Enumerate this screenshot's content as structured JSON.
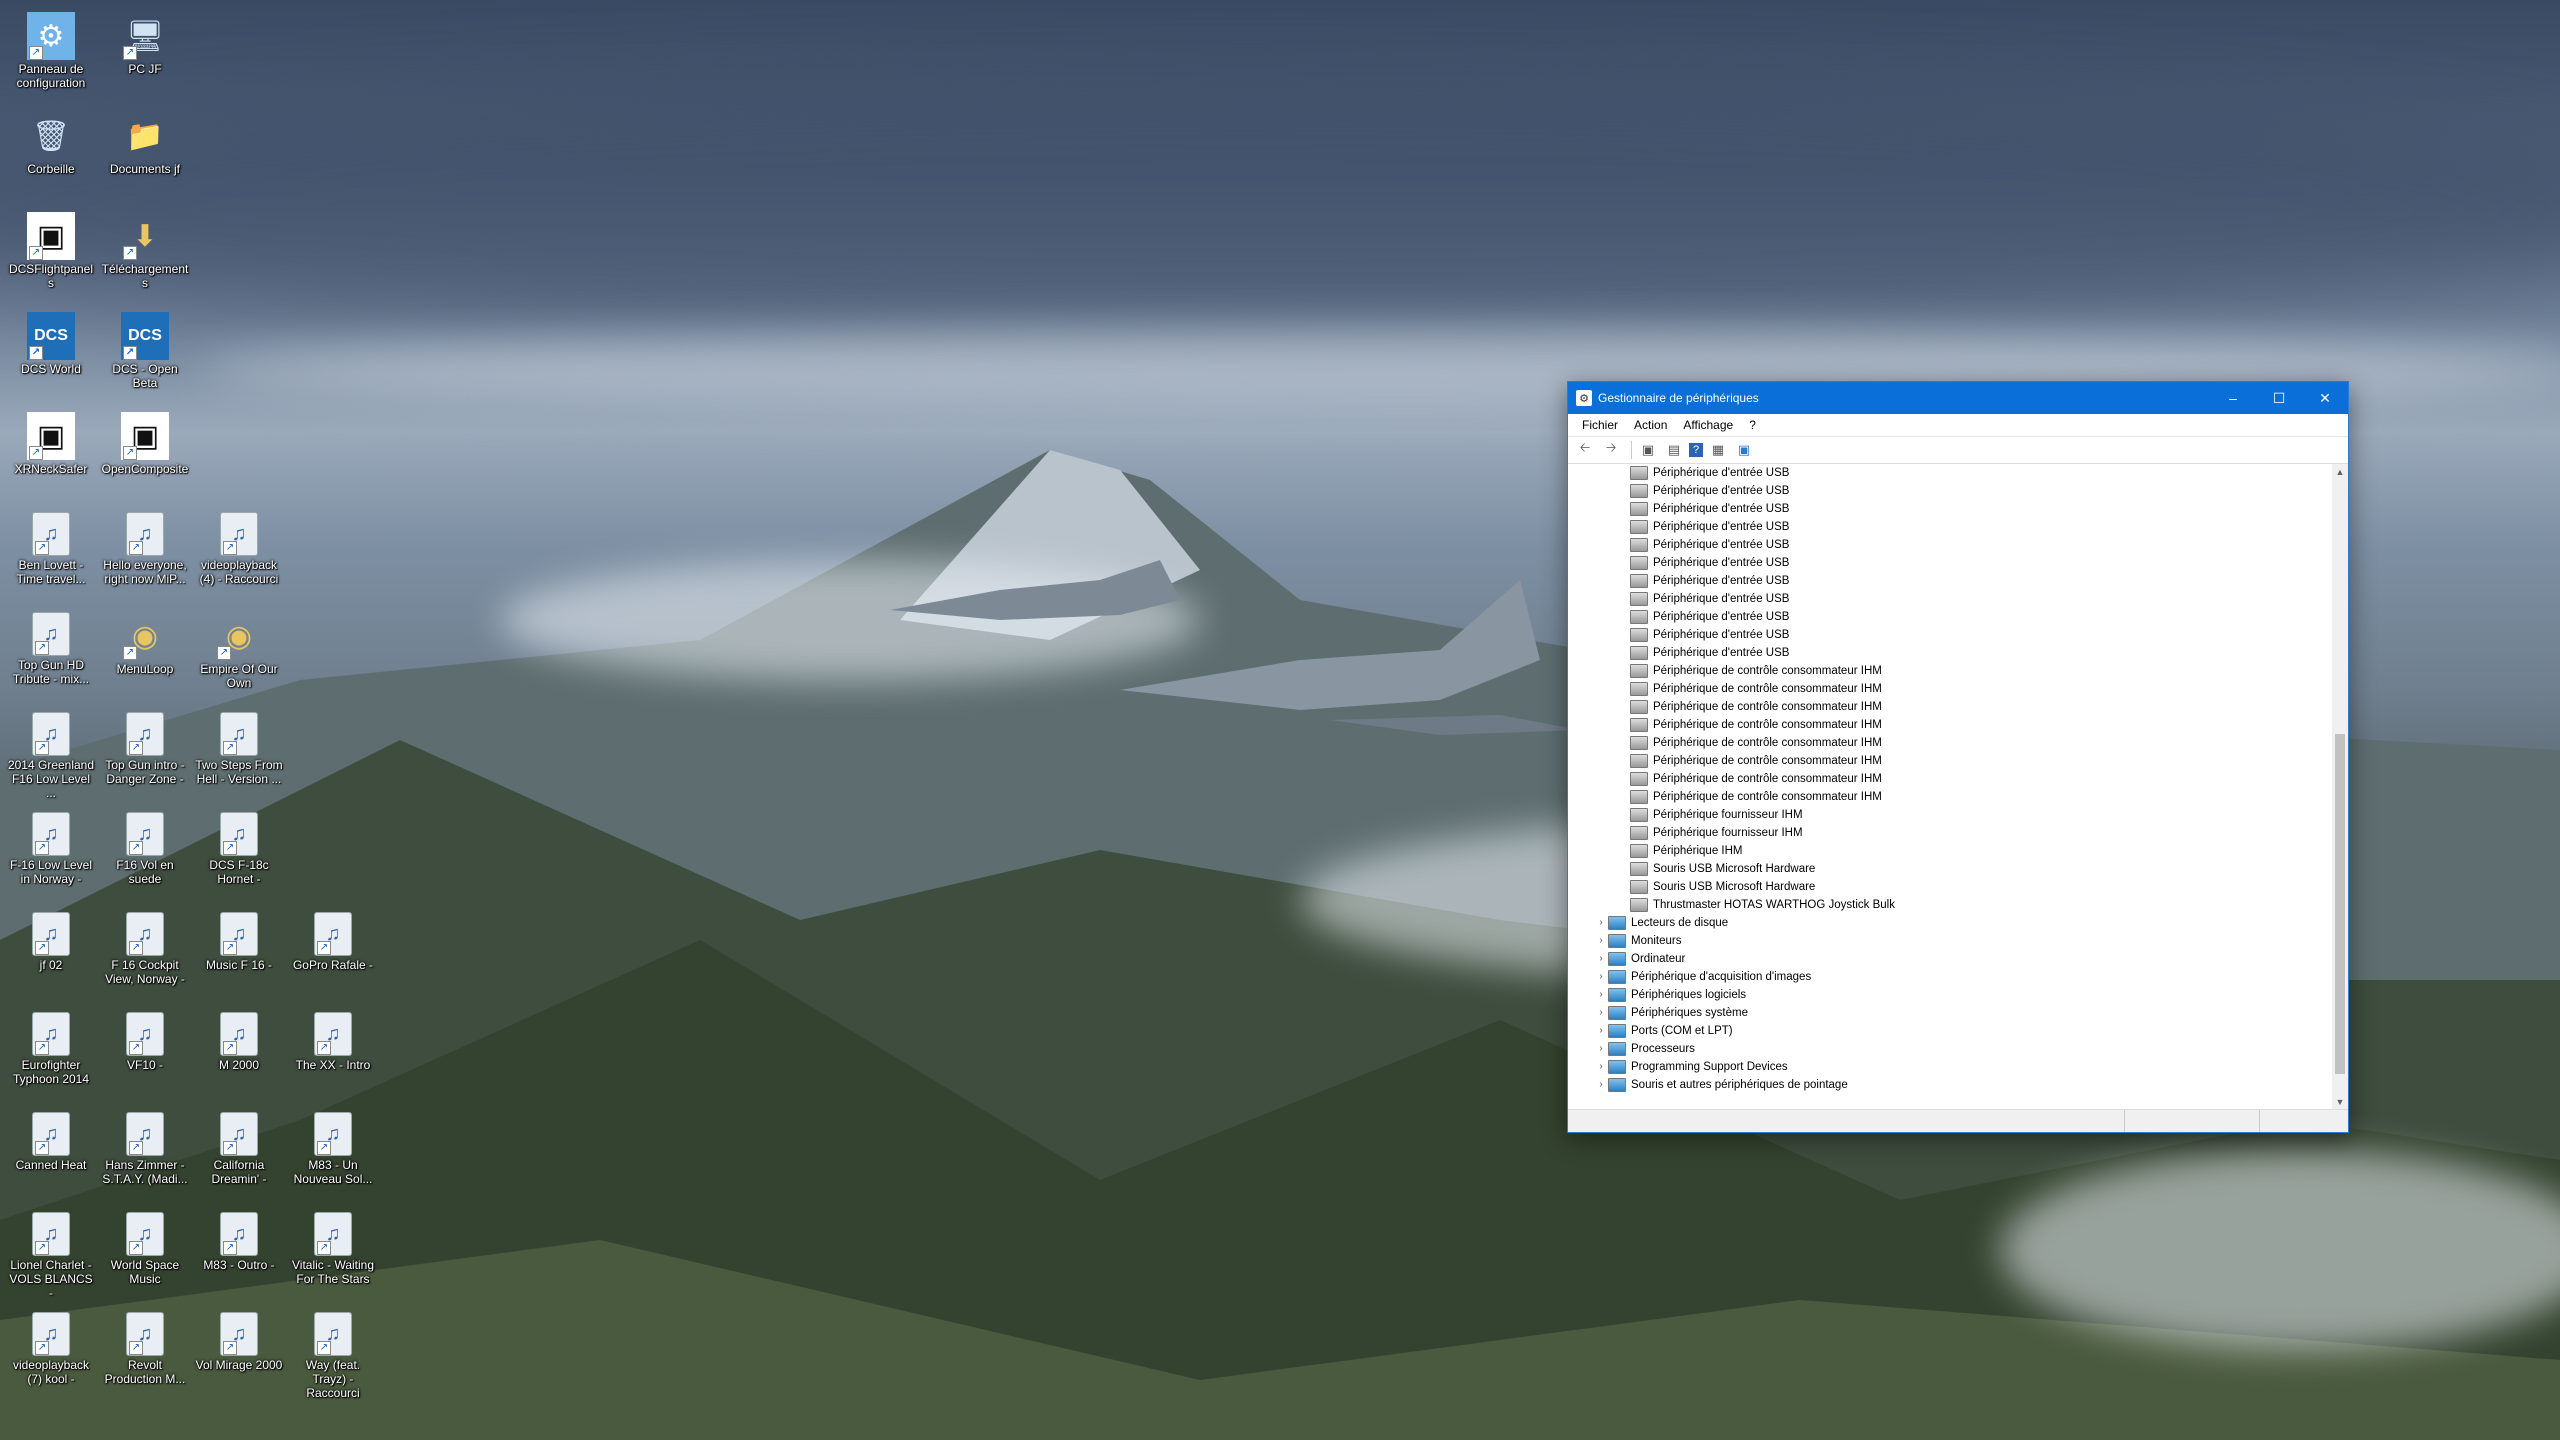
{
  "desktop": {
    "icons": [
      {
        "label": "Panneau de configuration",
        "icon": "control-panel-icon"
      },
      {
        "label": "PC JF",
        "icon": "computer-icon"
      },
      {
        "label": "Corbeille",
        "icon": "recycle-bin-icon"
      },
      {
        "label": "Documents jf",
        "icon": "folder-icon"
      },
      {
        "label": "DCSFlightpanels",
        "icon": "app-icon"
      },
      {
        "label": "Téléchargements",
        "icon": "downloads-folder-icon"
      },
      {
        "label": "DCS World",
        "icon": "dcs-icon"
      },
      {
        "label": "DCS - Open Beta",
        "icon": "dcs-icon"
      },
      {
        "label": "XRNeckSafer",
        "icon": "app-icon"
      },
      {
        "label": "OpenComposite",
        "icon": "app-icon"
      },
      {
        "label": "Ben Lovett - Time travel...",
        "icon": "media-file-icon"
      },
      {
        "label": "Hello everyone, right now MiP...",
        "icon": "media-file-icon"
      },
      {
        "label": "videoplayback (4) - Raccourci",
        "icon": "media-file-icon"
      },
      {
        "label": "Top Gun HD Tribute - mix...",
        "icon": "media-file-icon"
      },
      {
        "label": "MenuLoop",
        "icon": "audio-file-icon"
      },
      {
        "label": "Empire Of Our Own",
        "icon": "audio-file-icon"
      },
      {
        "label": "2014 Greenland F16 Low Level ...",
        "icon": "media-file-icon"
      },
      {
        "label": "Top Gun intro - Danger Zone -",
        "icon": "media-file-icon"
      },
      {
        "label": "Two Steps From Hell - Version ...",
        "icon": "media-file-icon"
      },
      {
        "label": "F-16 Low Level in Norway -",
        "icon": "media-file-icon"
      },
      {
        "label": "F16 Vol en suede",
        "icon": "media-file-icon"
      },
      {
        "label": "DCS F-18c Hornet -",
        "icon": "media-file-icon"
      },
      {
        "label": "jf 02",
        "icon": "media-file-icon"
      },
      {
        "label": "F 16 Cockpit View, Norway -",
        "icon": "media-file-icon"
      },
      {
        "label": "Music F 16 -",
        "icon": "media-file-icon"
      },
      {
        "label": "GoPro Rafale -",
        "icon": "media-file-icon"
      },
      {
        "label": "Eurofighter Typhoon 2014",
        "icon": "media-file-icon"
      },
      {
        "label": "VF10 -",
        "icon": "media-file-icon"
      },
      {
        "label": "M 2000",
        "icon": "media-file-icon"
      },
      {
        "label": "The XX - Intro",
        "icon": "media-file-icon"
      },
      {
        "label": "Canned Heat",
        "icon": "media-file-icon"
      },
      {
        "label": "Hans Zimmer - S.T.A.Y. (Madi...",
        "icon": "media-file-icon"
      },
      {
        "label": "California Dreamin' -",
        "icon": "media-file-icon"
      },
      {
        "label": "M83 - Un Nouveau Sol...",
        "icon": "media-file-icon"
      },
      {
        "label": "Lionel Charlet - VOLS BLANCS -",
        "icon": "media-file-icon"
      },
      {
        "label": "World Space Music",
        "icon": "media-file-icon"
      },
      {
        "label": "M83 - Outro -",
        "icon": "media-file-icon"
      },
      {
        "label": "Vitalic - Waiting For The Stars",
        "icon": "media-file-icon"
      },
      {
        "label": "videoplayback (7) kool -",
        "icon": "media-file-icon"
      },
      {
        "label": "Revolt Production M...",
        "icon": "media-file-icon"
      },
      {
        "label": "Vol Mirage 2000",
        "icon": "media-file-icon"
      },
      {
        "label": "Way (feat. Trayz) - Raccourci",
        "icon": "media-file-icon"
      }
    ]
  },
  "window": {
    "title": "Gestionnaire de périphériques",
    "controls": {
      "minimize": "–",
      "maximize": "☐",
      "close": "✕"
    },
    "menu": [
      "Fichier",
      "Action",
      "Affichage",
      "?"
    ],
    "toolbar_icons": [
      "back-arrow-icon",
      "forward-arrow-icon",
      "properties-icon",
      "list-view-icon",
      "help-icon",
      "show-hidden-icon",
      "monitor-icon"
    ],
    "devices": [
      "Périphérique d'entrée USB",
      "Périphérique d'entrée USB",
      "Périphérique d'entrée USB",
      "Périphérique d'entrée USB",
      "Périphérique d'entrée USB",
      "Périphérique d'entrée USB",
      "Périphérique d'entrée USB",
      "Périphérique d'entrée USB",
      "Périphérique d'entrée USB",
      "Périphérique d'entrée USB",
      "Périphérique d'entrée USB",
      "Périphérique de contrôle consommateur IHM",
      "Périphérique de contrôle consommateur IHM",
      "Périphérique de contrôle consommateur IHM",
      "Périphérique de contrôle consommateur IHM",
      "Périphérique de contrôle consommateur IHM",
      "Périphérique de contrôle consommateur IHM",
      "Périphérique de contrôle consommateur IHM",
      "Périphérique de contrôle consommateur IHM",
      "Périphérique fournisseur IHM",
      "Périphérique fournisseur IHM",
      "Périphérique IHM",
      "Souris USB Microsoft Hardware",
      "Souris USB Microsoft Hardware",
      "Thrustmaster HOTAS WARTHOG Joystick Bulk"
    ],
    "categories": [
      {
        "label": "Lecteurs de disque",
        "icon": "disk-drive-icon"
      },
      {
        "label": "Moniteurs",
        "icon": "monitor-icon"
      },
      {
        "label": "Ordinateur",
        "icon": "computer-icon"
      },
      {
        "label": "Périphérique d'acquisition d'images",
        "icon": "camera-icon"
      },
      {
        "label": "Périphériques logiciels",
        "icon": "software-device-icon"
      },
      {
        "label": "Périphériques système",
        "icon": "system-device-icon"
      },
      {
        "label": "Ports (COM et LPT)",
        "icon": "port-icon"
      },
      {
        "label": "Processeurs",
        "icon": "processor-icon"
      },
      {
        "label": "Programming Support Devices",
        "icon": "monitor-icon"
      },
      {
        "label": "Souris et autres périphériques de pointage",
        "icon": "mouse-icon"
      }
    ]
  }
}
